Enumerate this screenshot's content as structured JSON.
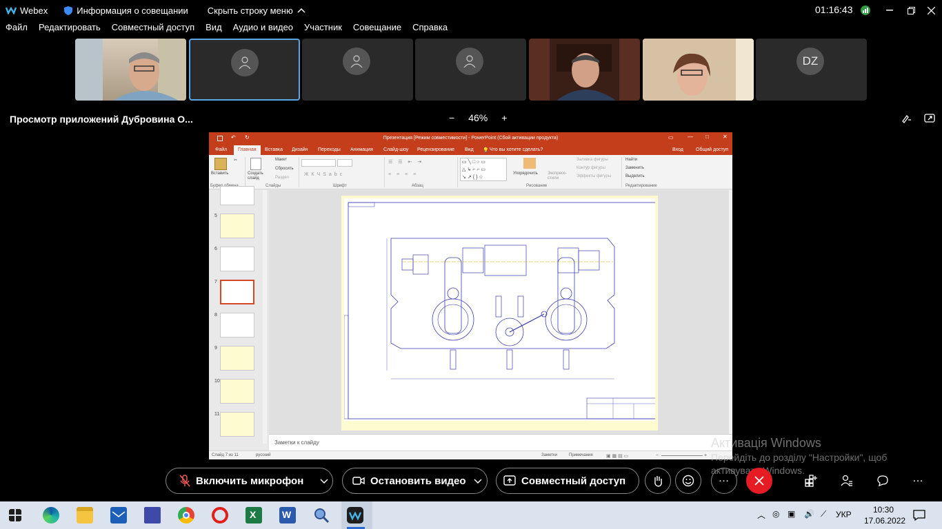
{
  "app": {
    "name": "Webex",
    "meeting_info": "Информация о совещании",
    "hide_menu": "Скрыть строку меню",
    "time": "01:16:43"
  },
  "menu": [
    "Файл",
    "Редактировать",
    "Совместный доступ",
    "Вид",
    "Аудио и видео",
    "Участник",
    "Совещание",
    "Справка"
  ],
  "participants": {
    "dz_initials": "DZ"
  },
  "viewbar": {
    "title": "Просмотр приложений Дубровина О...",
    "zoom_minus": "−",
    "zoom_value": "46%",
    "zoom_plus": "+"
  },
  "powerpoint": {
    "title": "Презентация [Режим совместимости] - PowerPoint (Сбой активации продукта)",
    "tabs": [
      "Файл",
      "Главная",
      "Вставка",
      "Дизайн",
      "Переходы",
      "Анимация",
      "Слайд-шоу",
      "Рецензирование",
      "Вид"
    ],
    "tell_me": "Что вы хотите сделать?",
    "sign_in": "Вход",
    "share": "Общий доступ",
    "ribbon": {
      "paste": "Вставить",
      "clipboard": "Буфер обмена",
      "create_slide": "Создать слайд",
      "layout": "Макет",
      "reset": "Сбросить",
      "section": "Раздел",
      "slides": "Слайды",
      "font": "Шрифт",
      "paragraph": "Абзац",
      "arrange": "Упорядочить",
      "express_styles": "Экспресс-стили",
      "shape_fill": "Заливка фигуры",
      "shape_outline": "Контур фигуры",
      "shape_effects": "Эффекты фигуры",
      "drawing": "Рисование",
      "find": "Найти",
      "replace": "Заменить",
      "select": "Выделить",
      "editing": "Редактирование"
    },
    "slide_numbers": [
      "5",
      "6",
      "7",
      "8",
      "9",
      "10",
      "11"
    ],
    "notes": "Заметки к слайду",
    "status_slide": "Слайд 7 из 11",
    "status_lang": "русский",
    "status_notes": "Заметки",
    "status_comments": "Примечания"
  },
  "watermark": {
    "line1": "Активація Windows",
    "line2": "Перейдіть до розділу \"Настройки\", щоб",
    "line3": "активувати Windows."
  },
  "controls": {
    "mute": "Включить микрофон",
    "video": "Остановить видео",
    "share": "Совместный доступ"
  },
  "taskbar": {
    "lang": "УКР",
    "time": "10:30",
    "date": "17.06.2022"
  },
  "colors": {
    "end_call": "#e51c24",
    "ppt_accent": "#c43e1c",
    "selected_tile": "#5aa7e8"
  }
}
